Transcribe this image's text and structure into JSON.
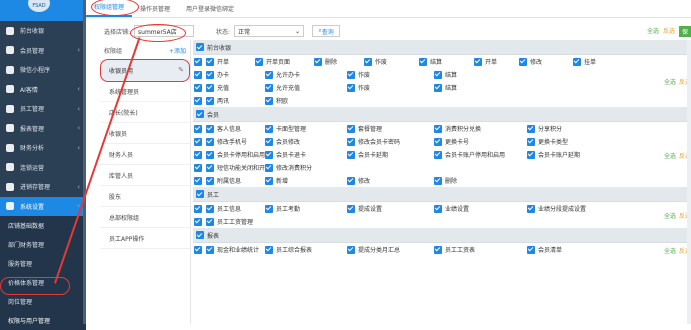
{
  "sidebar": {
    "avatar": "FSAD",
    "menu": [
      {
        "label": "前台收银",
        "icon": "home-icon",
        "sub": false
      },
      {
        "label": "会员管理",
        "icon": "user-icon",
        "sub": true
      },
      {
        "label": "微信小程序",
        "icon": "miniapp-icon",
        "sub": false
      },
      {
        "label": "AI客情",
        "icon": "ai-icon",
        "sub": true
      },
      {
        "label": "员工管理",
        "icon": "staff-icon",
        "sub": true
      },
      {
        "label": "报表管理",
        "icon": "report-icon",
        "sub": true
      },
      {
        "label": "财务分析",
        "icon": "finance-icon",
        "sub": true
      },
      {
        "label": "连锁运营",
        "icon": "chain-icon",
        "sub": false
      },
      {
        "label": "进销存管理",
        "icon": "inventory-icon",
        "sub": true
      },
      {
        "label": "系统设置",
        "icon": "settings-icon",
        "sub": true
      }
    ],
    "submenu": [
      "店铺基础数据",
      "部门财务管理",
      "服务管理",
      "价格体系管理",
      "岗位管理",
      "权限与用户管理"
    ]
  },
  "tabs": [
    "权限组管理",
    "操作员管理",
    "用户登录微信绑定"
  ],
  "filter": {
    "store_label": "选择店铺:",
    "store_value": "summer5A店",
    "status_label": "状态:",
    "status_value": "正常",
    "query": "查询"
  },
  "top_right": {
    "select_all": "全选",
    "invert": "反选",
    "save": "保"
  },
  "groups": {
    "title": "权限组",
    "add": "+添加",
    "items": [
      "收银员用",
      "系统管理员",
      "店长(院长)",
      "收银员",
      "财务人员",
      "库管人员",
      "股东",
      "总部权限组",
      "员工APP操作"
    ]
  },
  "row_links": {
    "all": "全选",
    "inv": "反选"
  },
  "sections": [
    {
      "title": "前台收银",
      "rows": [
        [
          "开单",
          "开单页面",
          "删除",
          "作废",
          "结算",
          "开单",
          "修改",
          "挂单"
        ],
        [
          "办卡",
          "允许办卡",
          "作废",
          "结算"
        ],
        [
          "充值",
          "允许充值",
          "作废",
          "结算"
        ],
        [
          "两讯",
          "积欧"
        ]
      ]
    },
    {
      "title": "会员",
      "rows": [
        [
          "客人信息",
          "卡面型管理",
          "套餐管理",
          "消费积分兑换",
          "分享积分"
        ],
        [
          "修改手机号",
          "会员修改",
          "修改会员卡密码",
          "更换卡号",
          "更换卡类型"
        ],
        [
          "会员卡停用和启用",
          "会员卡退卡",
          "会员卡延期",
          "会员卡账户停用和启用",
          "会员卡账户延期"
        ],
        [
          "短信功能关闭和开启",
          "修改消费积分"
        ],
        [
          "附属信息",
          "新增",
          "修改",
          "删除"
        ]
      ]
    },
    {
      "title": "员工",
      "rows": [
        [
          "员工信息",
          "员工考勤",
          "提成设置",
          "业绩设置",
          "业绩分段提成设置"
        ],
        [
          "员工工资管理"
        ]
      ]
    },
    {
      "title": "报表",
      "rows": [
        [
          "现金和业绩统计",
          "员工综合报表",
          "提成分类月汇总",
          "员工工资表",
          "会员清单"
        ]
      ]
    }
  ]
}
